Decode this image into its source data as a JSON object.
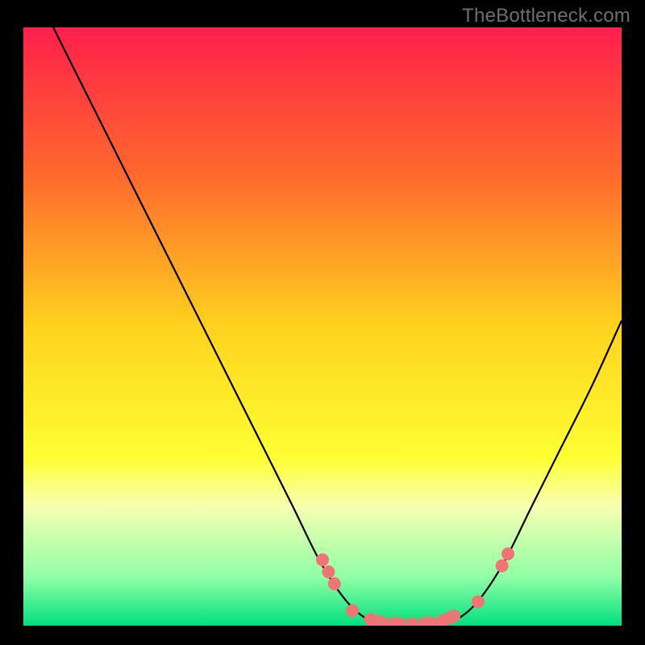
{
  "watermark": "TheBottleneck.com",
  "chart_data": {
    "type": "line",
    "title": "",
    "xlabel": "",
    "ylabel": "",
    "xlim": [
      0,
      100
    ],
    "ylim": [
      0,
      100
    ],
    "background_gradient": {
      "stops": [
        {
          "offset": 0,
          "color": "#ff1f4b"
        },
        {
          "offset": 25,
          "color": "#ff6a2d"
        },
        {
          "offset": 50,
          "color": "#ffd21f"
        },
        {
          "offset": 72,
          "color": "#ffff33"
        },
        {
          "offset": 80,
          "color": "#f7ffb0"
        },
        {
          "offset": 92,
          "color": "#8effa6"
        },
        {
          "offset": 100,
          "color": "#00e07e"
        }
      ]
    },
    "curve": [
      {
        "x": 5,
        "y": 100
      },
      {
        "x": 10,
        "y": 90
      },
      {
        "x": 15,
        "y": 80
      },
      {
        "x": 20,
        "y": 70
      },
      {
        "x": 25,
        "y": 60
      },
      {
        "x": 30,
        "y": 50
      },
      {
        "x": 35,
        "y": 40
      },
      {
        "x": 40,
        "y": 30
      },
      {
        "x": 45,
        "y": 20
      },
      {
        "x": 50,
        "y": 10
      },
      {
        "x": 55,
        "y": 3
      },
      {
        "x": 60,
        "y": 0
      },
      {
        "x": 65,
        "y": 0
      },
      {
        "x": 70,
        "y": 0
      },
      {
        "x": 75,
        "y": 3
      },
      {
        "x": 80,
        "y": 10
      },
      {
        "x": 85,
        "y": 20
      },
      {
        "x": 90,
        "y": 30
      },
      {
        "x": 95,
        "y": 40
      },
      {
        "x": 100,
        "y": 51
      }
    ],
    "markers": [
      {
        "x": 50,
        "y": 11
      },
      {
        "x": 51,
        "y": 9
      },
      {
        "x": 52,
        "y": 7
      },
      {
        "x": 55,
        "y": 2.5
      },
      {
        "x": 58,
        "y": 1.0
      },
      {
        "x": 59,
        "y": 0.8
      },
      {
        "x": 60,
        "y": 0.5
      },
      {
        "x": 62,
        "y": 0.4
      },
      {
        "x": 63,
        "y": 0.3
      },
      {
        "x": 65,
        "y": 0.3
      },
      {
        "x": 67,
        "y": 0.4
      },
      {
        "x": 68,
        "y": 0.5
      },
      {
        "x": 70,
        "y": 0.8
      },
      {
        "x": 71,
        "y": 1.2
      },
      {
        "x": 72,
        "y": 1.6
      },
      {
        "x": 76,
        "y": 4
      },
      {
        "x": 80,
        "y": 10
      },
      {
        "x": 81,
        "y": 12
      }
    ],
    "marker_color": "#ef7575",
    "marker_radius": 8,
    "curve_color": "#000000",
    "curve_width": 2.2
  }
}
